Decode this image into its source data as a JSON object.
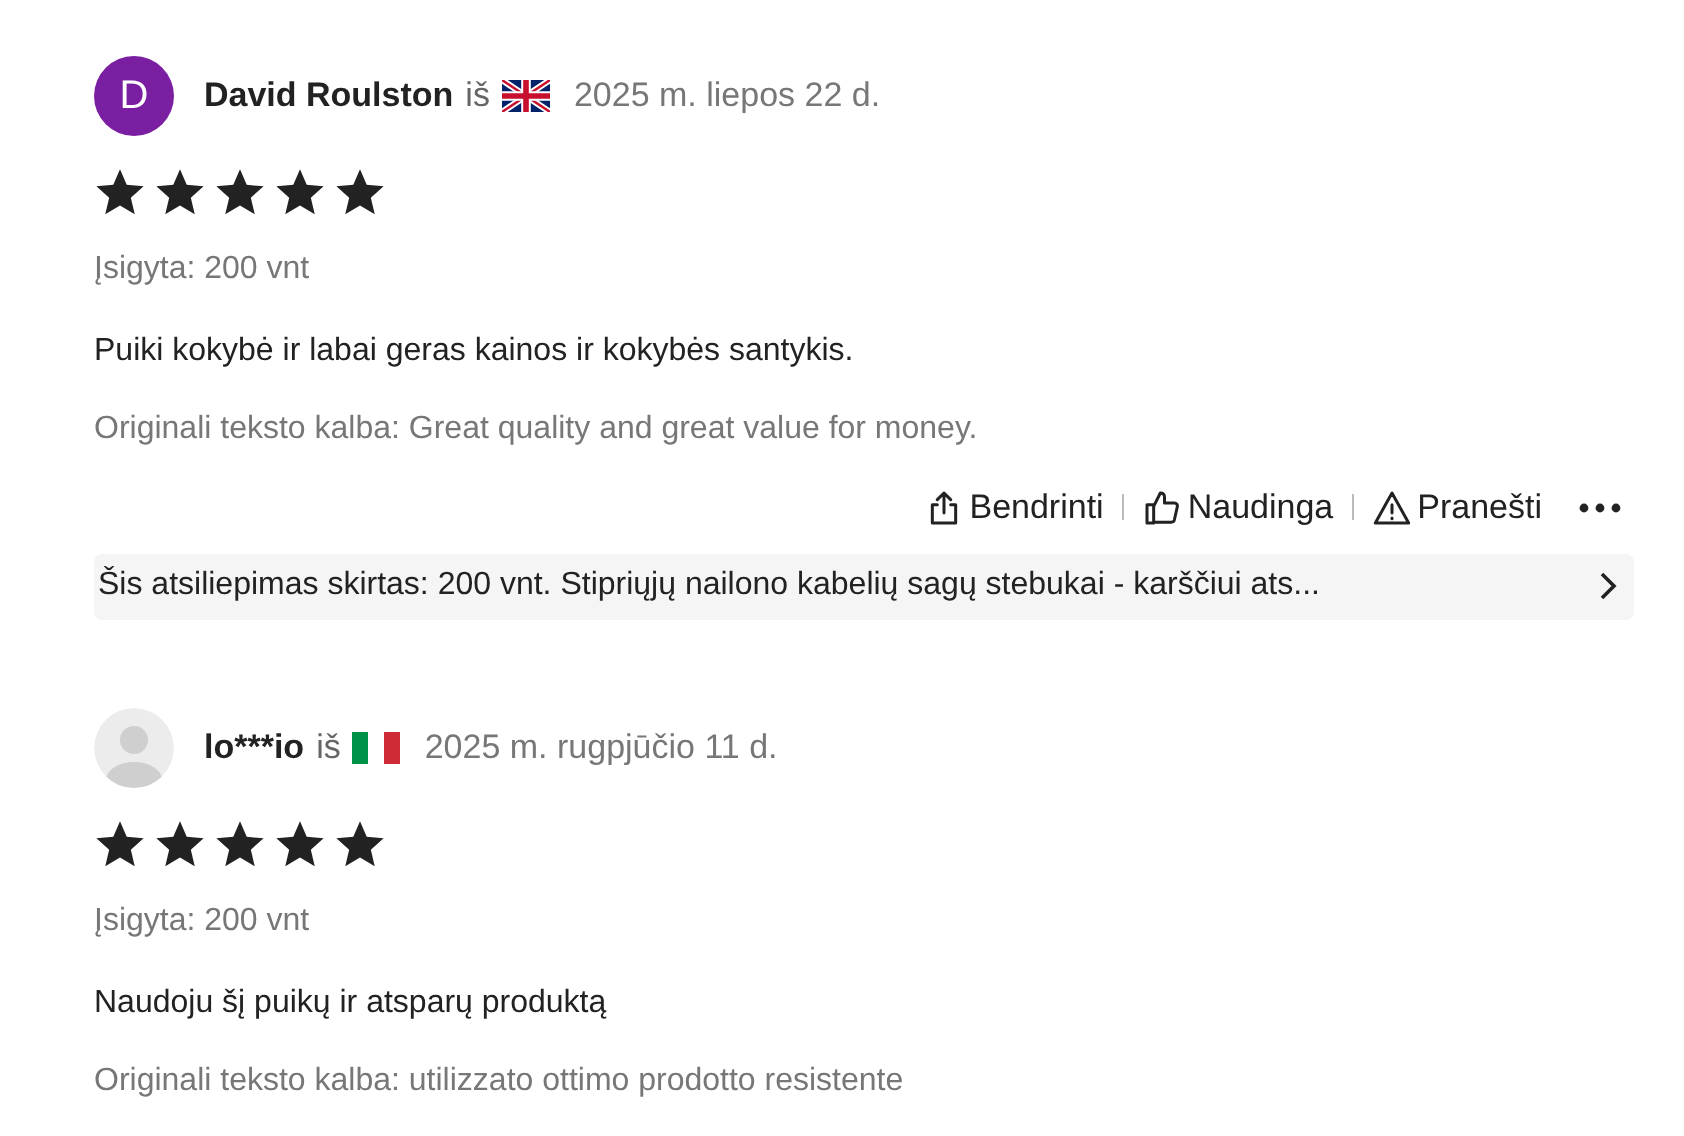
{
  "reviews": [
    {
      "avatar": {
        "kind": "letter",
        "letter": "D",
        "color": "#7b1fa2"
      },
      "name": "David Roulston",
      "from": "iš",
      "flag": {
        "kind": "uk"
      },
      "date": "2025 m. liepos 22 d.",
      "stars": 5,
      "purchased": "Įsigyta: 200 vnt",
      "text": "Puiki kokybė ir labai geras kainos ir kokybės santykis.",
      "original": "Originali teksto kalba: Great quality and great value for money.",
      "actions": [
        {
          "kind": "share",
          "label": "Bendrinti"
        },
        {
          "kind": "helpful",
          "label": "Naudinga"
        },
        {
          "kind": "report",
          "label": "Pranešti"
        }
      ],
      "product": "Šis atsiliepimas skirtas: 200 vnt. Stipriųjų nailono kabelių sagų stebukai - karščiui ats..."
    },
    {
      "avatar": {
        "kind": "generic"
      },
      "name": "lo***io",
      "from": "iš",
      "flag": {
        "kind": "it"
      },
      "date": "2025 m. rugpjūčio 11 d.",
      "stars": 5,
      "purchased": "Įsigyta: 200 vnt",
      "text": "Naudoju šį puikų ir atsparų produktą",
      "original": "Originali teksto kalba: utilizzato ottimo prodotto resistente"
    }
  ]
}
